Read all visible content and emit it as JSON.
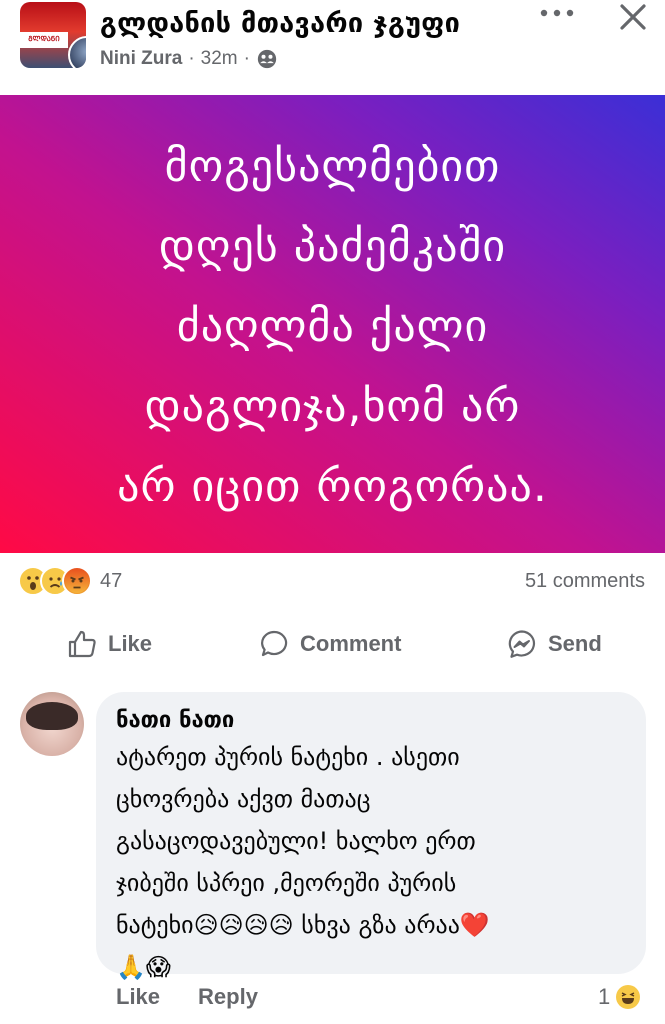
{
  "post": {
    "group_name": "გლდანის მთავარი ჯგუფი",
    "author": "Nini Zura",
    "time": "32m",
    "separator": "·",
    "more_icon": "more-dots-icon",
    "close_icon": "close-icon",
    "privacy_icon": "group-members-icon",
    "avatar_banner_text": "ᲒᲚᲓᲐᲜᲘ",
    "text": "მოგესალმებით\nდღეს პაძემკაში\nძაღლმა ქალი\nდაგლიჯა,ხომ არ\nარ იცით როგორაა.",
    "background_colors": [
      "#ff0a45",
      "#c2128f",
      "#7a1fc0",
      "#3b2fd6"
    ]
  },
  "stats": {
    "reactions": [
      "wow",
      "sad",
      "angry"
    ],
    "reaction_count": "47",
    "comments": "51 comments"
  },
  "actions": {
    "like": "Like",
    "comment": "Comment",
    "send": "Send"
  },
  "comment": {
    "author": "ნათი ნათი",
    "text": "ატარეთ პურის ნატეხი . ასეთი\nცხოვრება აქვთ მათაც\nგასაცოდავებული! ხალხო ერთ\nჯიბეში სპრეი ,მეორეში პურის\nნატეხი😥😥😥😥 სხვა გზა არაა❤️\n🙏😱",
    "like": "Like",
    "reply": "Reply",
    "reaction_count": "1",
    "reaction_icon": "haha-icon"
  },
  "colors": {
    "text_secondary": "#65676b",
    "bubble": "#f0f2f5"
  }
}
